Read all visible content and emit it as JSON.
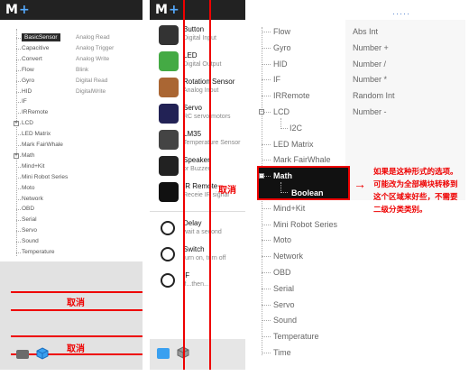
{
  "panel1": {
    "brand_m": "M",
    "brand_plus": "+",
    "dots": "·····",
    "tree": [
      {
        "label": "BasicSensor"
      },
      {
        "label": "Capacitive"
      },
      {
        "label": "Convert"
      },
      {
        "label": "Flow"
      },
      {
        "label": "Gyro"
      },
      {
        "label": "HID"
      },
      {
        "label": "IF"
      },
      {
        "label": "IRRemote"
      },
      {
        "label": "LCD"
      },
      {
        "label": "LED Matrix"
      },
      {
        "label": "Mark FairWhale"
      },
      {
        "label": "Math"
      },
      {
        "label": "Mind+Kit"
      },
      {
        "label": "Mini Robot Series"
      },
      {
        "label": "Moto"
      },
      {
        "label": "Network"
      },
      {
        "label": "OBD"
      },
      {
        "label": "Serial"
      },
      {
        "label": "Servo"
      },
      {
        "label": "Sound"
      },
      {
        "label": "Temperature"
      }
    ],
    "expander": "+",
    "blocks": [
      "Analog Read",
      "Analog Trigger",
      "Analog Write",
      "Blink",
      "Digital Read",
      "DigitalWrite"
    ],
    "cancel_1": "取消",
    "cancel_2": "取消"
  },
  "panel2": {
    "brand_m": "M",
    "brand_plus": "+",
    "items": [
      {
        "title": "Button",
        "subtitle": "Digital Input"
      },
      {
        "title": "LED",
        "subtitle": "Digital Output"
      },
      {
        "title": "Rotation Sensor",
        "subtitle": "Analog Input"
      },
      {
        "title": "Servo",
        "subtitle": "RC servo motors"
      },
      {
        "title": "LM35",
        "subtitle": "Temperature Sensor"
      },
      {
        "title": "Speaker",
        "subtitle": "or Buzzer"
      },
      {
        "title": "IR Remote",
        "subtitle": "Receie IR signal"
      },
      {
        "title": "Delay",
        "subtitle": "wait a second"
      },
      {
        "title": "Switch",
        "subtitle": "turn on, turn off"
      },
      {
        "title": "IF",
        "subtitle": "if...then..."
      }
    ],
    "cancel": "取消"
  },
  "panel3": {
    "dots": "·····",
    "tree": [
      {
        "label": "Flow"
      },
      {
        "label": "Gyro"
      },
      {
        "label": "HID"
      },
      {
        "label": "IF"
      },
      {
        "label": "IRRemote"
      },
      {
        "label": "LCD"
      },
      {
        "label": "I2C"
      },
      {
        "label": "LED Matrix"
      },
      {
        "label": "Mark FairWhale"
      },
      {
        "label": "Math"
      },
      {
        "label": "Boolean"
      },
      {
        "label": "Mind+Kit"
      },
      {
        "label": "Mini Robot Series"
      },
      {
        "label": "Moto"
      },
      {
        "label": "Network"
      },
      {
        "label": "OBD"
      },
      {
        "label": "Serial"
      },
      {
        "label": "Servo"
      },
      {
        "label": "Sound"
      },
      {
        "label": "Temperature"
      },
      {
        "label": "Time"
      }
    ],
    "collapse": "−",
    "blocks": [
      "Abs Int",
      "Number +",
      "Number /",
      "Number *",
      "Random Int",
      "Number -"
    ],
    "annotation": "如果是这种形式的选项。可能改为全部横块转移到这个区域来好些，不需要二级分类类别。",
    "arrow": "→"
  },
  "colors": {
    "accent": "#e00000",
    "selected_bg": "#111111",
    "brand_blue": "#4aa3ff"
  }
}
